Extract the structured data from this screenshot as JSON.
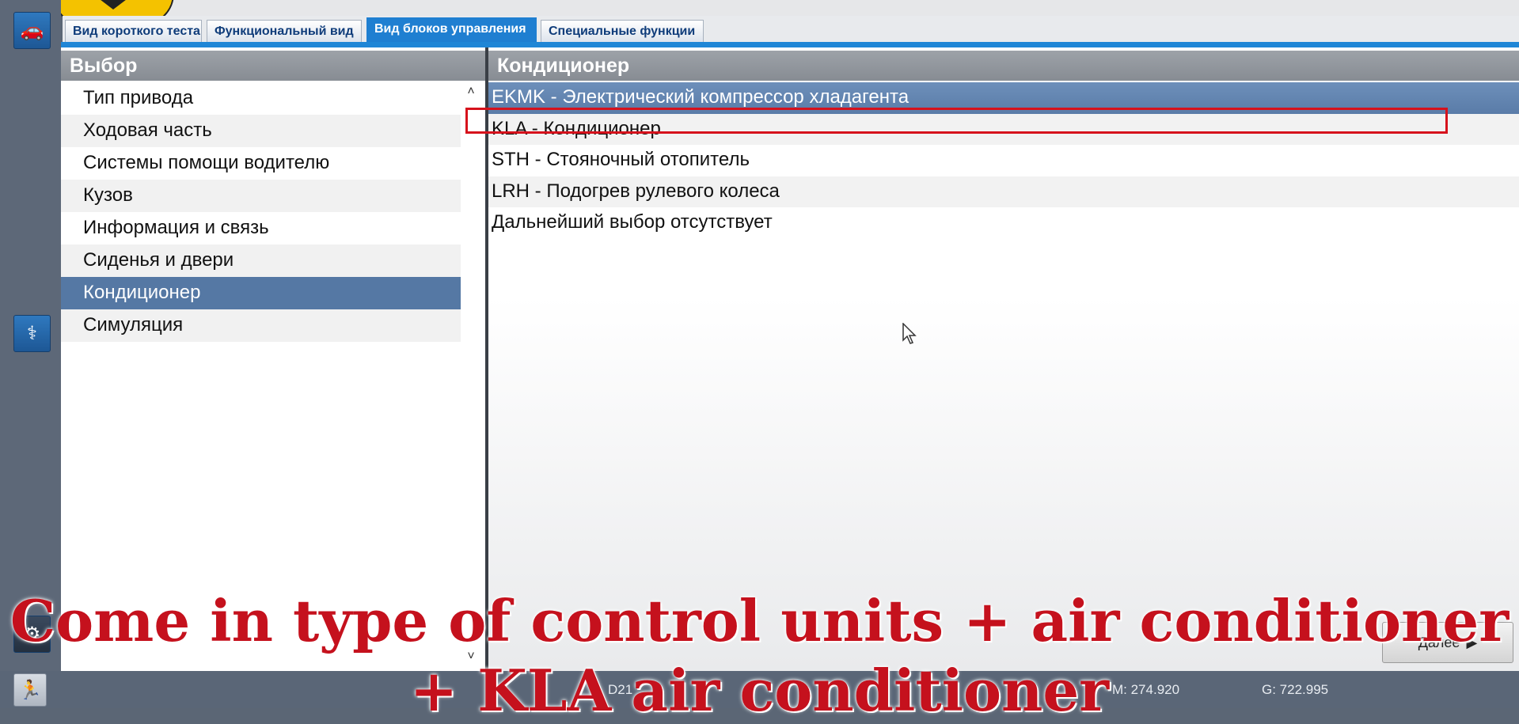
{
  "tabs": [
    {
      "label": "Вид короткого теста",
      "active": false
    },
    {
      "label": "Функциональный вид",
      "active": false
    },
    {
      "label": "Вид блоков управления",
      "active": true
    },
    {
      "label": "Специальные функции",
      "active": false
    }
  ],
  "left_panel": {
    "header": "Выбор",
    "items": [
      "Тип привода",
      "Ходовая часть",
      "Системы помощи водителю",
      "Кузов",
      "Информация и связь",
      "Сиденья и двери",
      "Кондиционер",
      "Симуляция"
    ],
    "selected_index": 6
  },
  "right_panel": {
    "header": "Кондиционер",
    "items": [
      "EKMK - Электрический компрессор хладагента",
      "KLA - Кондиционер",
      "STH - Стояночный отопитель",
      "LRH - Подогрев рулевого колеса",
      "Дальнейший выбор отсутствует"
    ],
    "selected_index": 0,
    "highlighted_index": 1
  },
  "buttons": {
    "next_label": "Далее"
  },
  "statusbar": {
    "code": "D21",
    "m_value": "M: 274.920",
    "g_value": "G: 722.995"
  },
  "caption": {
    "line1": "Come in type of control units + air conditioner",
    "line2": "+ KLA air conditioner"
  },
  "colors": {
    "accent": "#1f7fd1",
    "selection": "#5578a4",
    "highlight": "#d6121c",
    "caption": "#c5111d"
  }
}
